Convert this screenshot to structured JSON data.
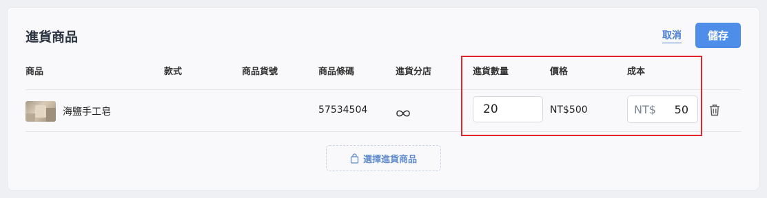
{
  "header": {
    "title": "進貨商品",
    "cancel_label": "取消",
    "save_label": "儲存"
  },
  "table": {
    "columns": [
      "商品",
      "款式",
      "商品貨號",
      "商品條碼",
      "進貨分店",
      "進貨數量",
      "價格",
      "成本"
    ],
    "rows": [
      {
        "product_name": "海鹽手工皂",
        "variant": "",
        "sku": "",
        "barcode": "57534504",
        "branch_icon": "infinity-icon",
        "quantity": "20",
        "price": "NT$500",
        "cost_prefix": "NT$",
        "cost": "50"
      }
    ]
  },
  "select_product_label": "選擇進貨商品",
  "colors": {
    "accent": "#4f8ee8",
    "highlight": "#e3242b"
  }
}
